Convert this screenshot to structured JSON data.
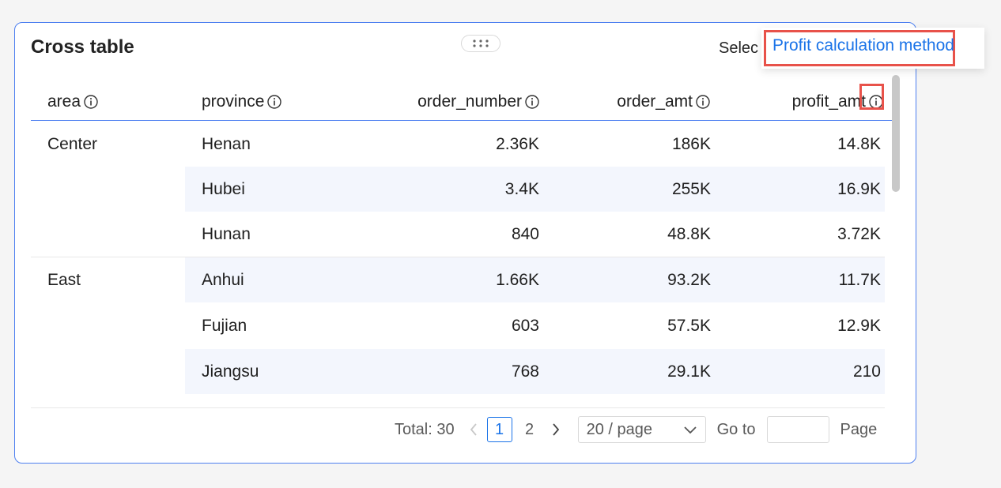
{
  "card": {
    "title": "Cross table",
    "select_label": "Selec"
  },
  "tooltip": {
    "text": "Profit calculation method"
  },
  "columns": [
    "area",
    "province",
    "order_number",
    "order_amt",
    "profit_amt"
  ],
  "groups": [
    {
      "area": "Center",
      "rows": [
        {
          "province": "Henan",
          "order_number": "2.36K",
          "order_amt": "186K",
          "profit_amt": "14.8K"
        },
        {
          "province": "Hubei",
          "order_number": "3.4K",
          "order_amt": "255K",
          "profit_amt": "16.9K"
        },
        {
          "province": "Hunan",
          "order_number": "840",
          "order_amt": "48.8K",
          "profit_amt": "3.72K"
        }
      ]
    },
    {
      "area": "East",
      "rows": [
        {
          "province": "Anhui",
          "order_number": "1.66K",
          "order_amt": "93.2K",
          "profit_amt": "11.7K"
        },
        {
          "province": "Fujian",
          "order_number": "603",
          "order_amt": "57.5K",
          "profit_amt": "12.9K"
        },
        {
          "province": "Jiangsu",
          "order_number": "768",
          "order_amt": "29.1K",
          "profit_amt": "210"
        }
      ]
    }
  ],
  "pagination": {
    "total_label": "Total: 30",
    "pages": [
      "1",
      "2"
    ],
    "current_page": "1",
    "page_size": "20 / page",
    "goto_label": "Go to",
    "goto_value": "",
    "page_label": "Page"
  },
  "colors": {
    "accent": "#4d7ff0",
    "link": "#1a73e8",
    "highlight": "#e8524a",
    "stripe": "#f3f6fd"
  }
}
